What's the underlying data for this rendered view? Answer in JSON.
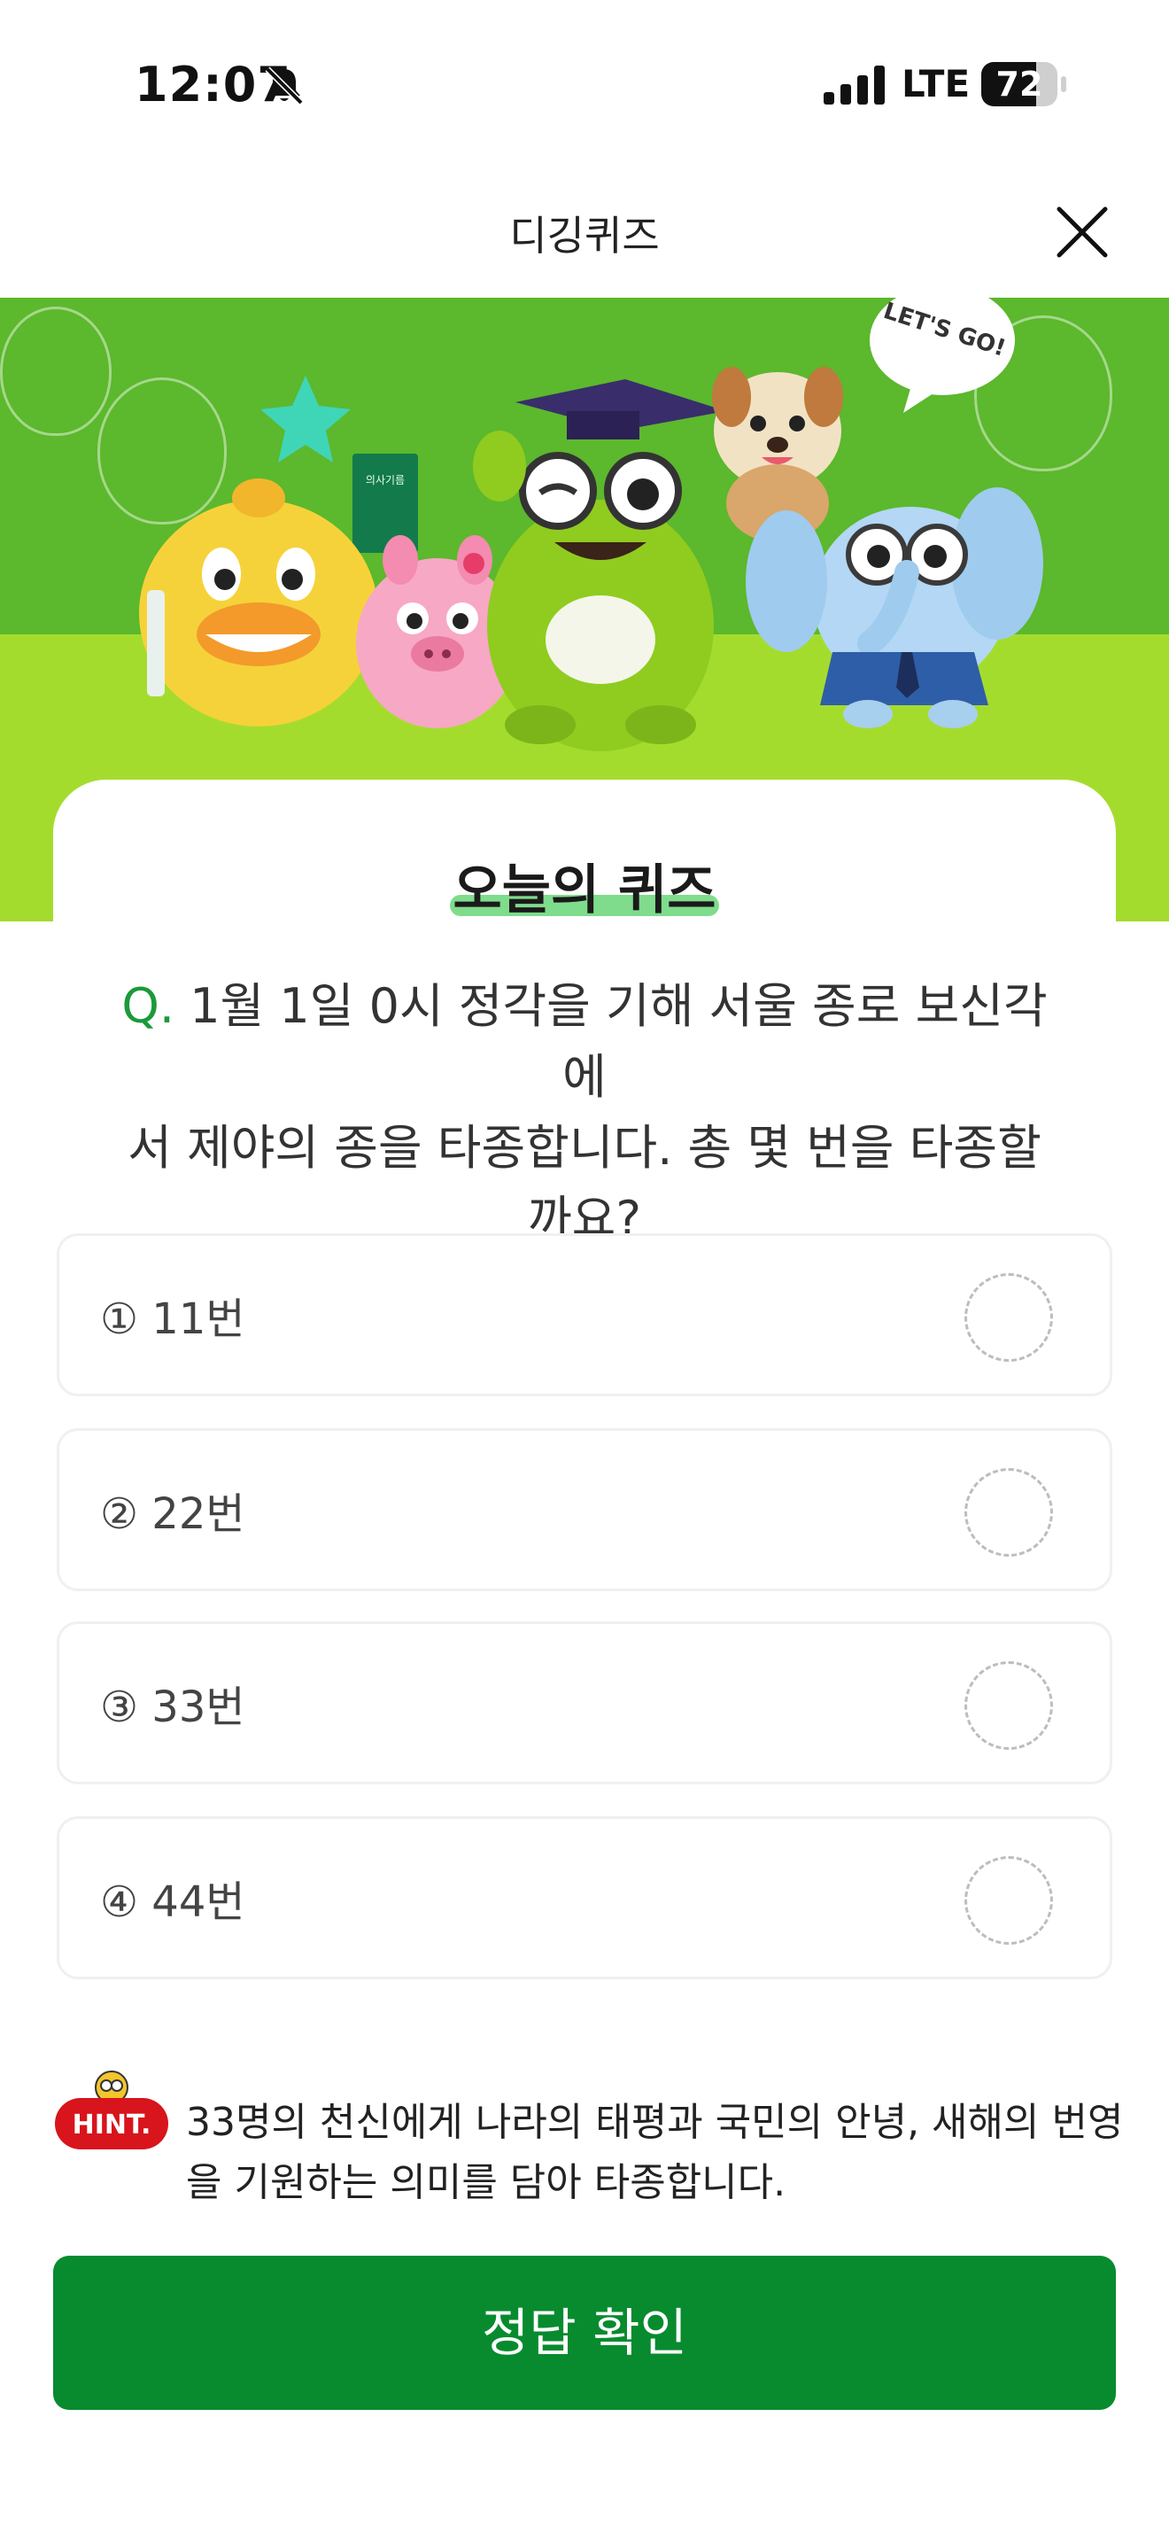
{
  "status_bar": {
    "time": "12:07",
    "network": "LTE",
    "battery_percent": "72",
    "battery_level": 0.72,
    "icons": [
      "bell-slash-icon",
      "signal-icon",
      "battery-icon"
    ]
  },
  "nav": {
    "title": "디깅퀴즈",
    "close_icon": "close-icon"
  },
  "hero": {
    "speech_bubble": "LET'S GO!",
    "book_label": "의사기름",
    "colors": {
      "sky": "#5cb82c",
      "ground": "#a4dc2e"
    }
  },
  "quiz": {
    "heading": "오늘의 퀴즈",
    "question_prefix": "Q.",
    "question_line1": "1월 1일 0시 정각을 기해 서울 종로 보신각에",
    "question_line2": "서 제야의 종을 타종합니다. 총 몇 번을 타종할",
    "question_line3": "까요?",
    "options": [
      {
        "label": "① 11번"
      },
      {
        "label": "② 22번"
      },
      {
        "label": "③ 33번"
      },
      {
        "label": "④ 44번"
      }
    ]
  },
  "hint": {
    "badge": "HINT.",
    "line1": "33명의 천신에게 나라의 태평과 국민의 안녕, 새해의 번영",
    "line2": "을 기원하는 의미를 담아 타종합니다."
  },
  "confirm_button": {
    "label": "정답 확인",
    "color": "#078b2e"
  }
}
